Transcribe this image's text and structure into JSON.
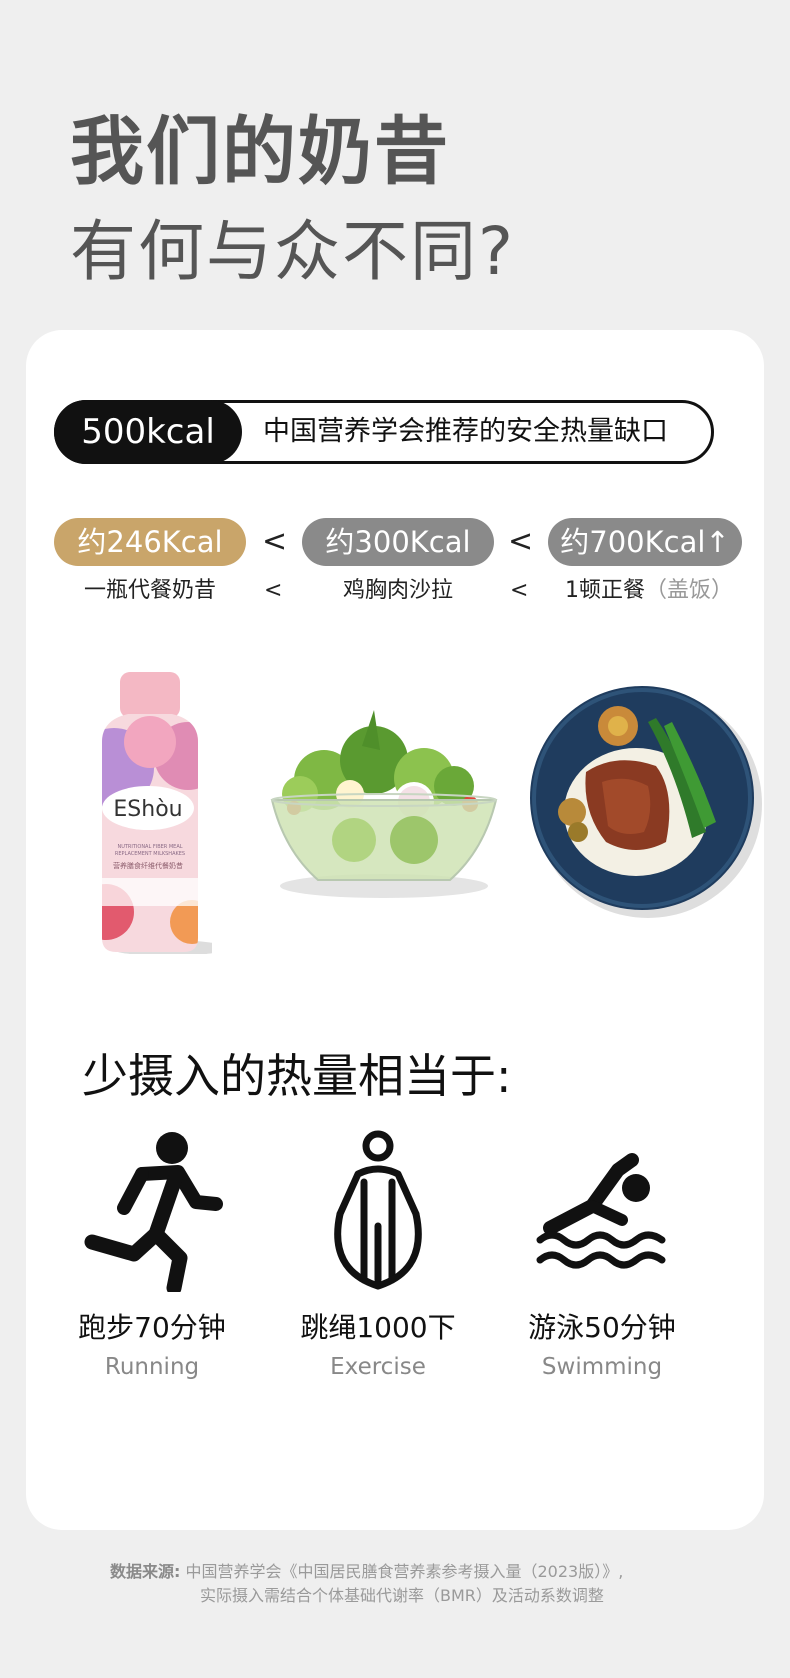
{
  "heading": {
    "line1": "我们的奶昔",
    "line2": "有何与众不同?"
  },
  "gap": {
    "value": "500kcal",
    "description": "中国营养学会推荐的安全热量缺口"
  },
  "comparison": {
    "items": [
      {
        "kcal": "约246Kcal",
        "label": "一瓶代餐奶昔",
        "label_extra": ""
      },
      {
        "kcal": "约300Kcal",
        "label": "鸡胸肉沙拉",
        "label_extra": ""
      },
      {
        "kcal": "约700Kcal↑",
        "label": "1顿正餐",
        "label_extra": "（盖饭）"
      }
    ],
    "less_than": "<",
    "colors": {
      "highlight": "#c9a56a",
      "neutral": "#8a8a8a"
    }
  },
  "product": {
    "brand": "EShòu",
    "line1": "NUTRITIONAL FIBER MEAL",
    "line2": "REPLACEMENT MILKSHAKES",
    "cn_name": "营养膳食纤维代餐奶昔"
  },
  "equivalent": {
    "heading": "少摄入的热量相当于:",
    "activities": [
      {
        "icon": "running-icon",
        "cn": "跑步70分钟",
        "en": "Running"
      },
      {
        "icon": "jump-rope-icon",
        "cn": "跳绳1000下",
        "en": "Exercise"
      },
      {
        "icon": "swimming-icon",
        "cn": "游泳50分钟",
        "en": "Swimming"
      }
    ]
  },
  "footnote": {
    "label": "数据来源:",
    "line1": "中国营养学会《中国居民膳食营养素参考摄入量（2023版）》,",
    "line2": "实际摄入需结合个体基础代谢率（BMR）及活动系数调整"
  }
}
